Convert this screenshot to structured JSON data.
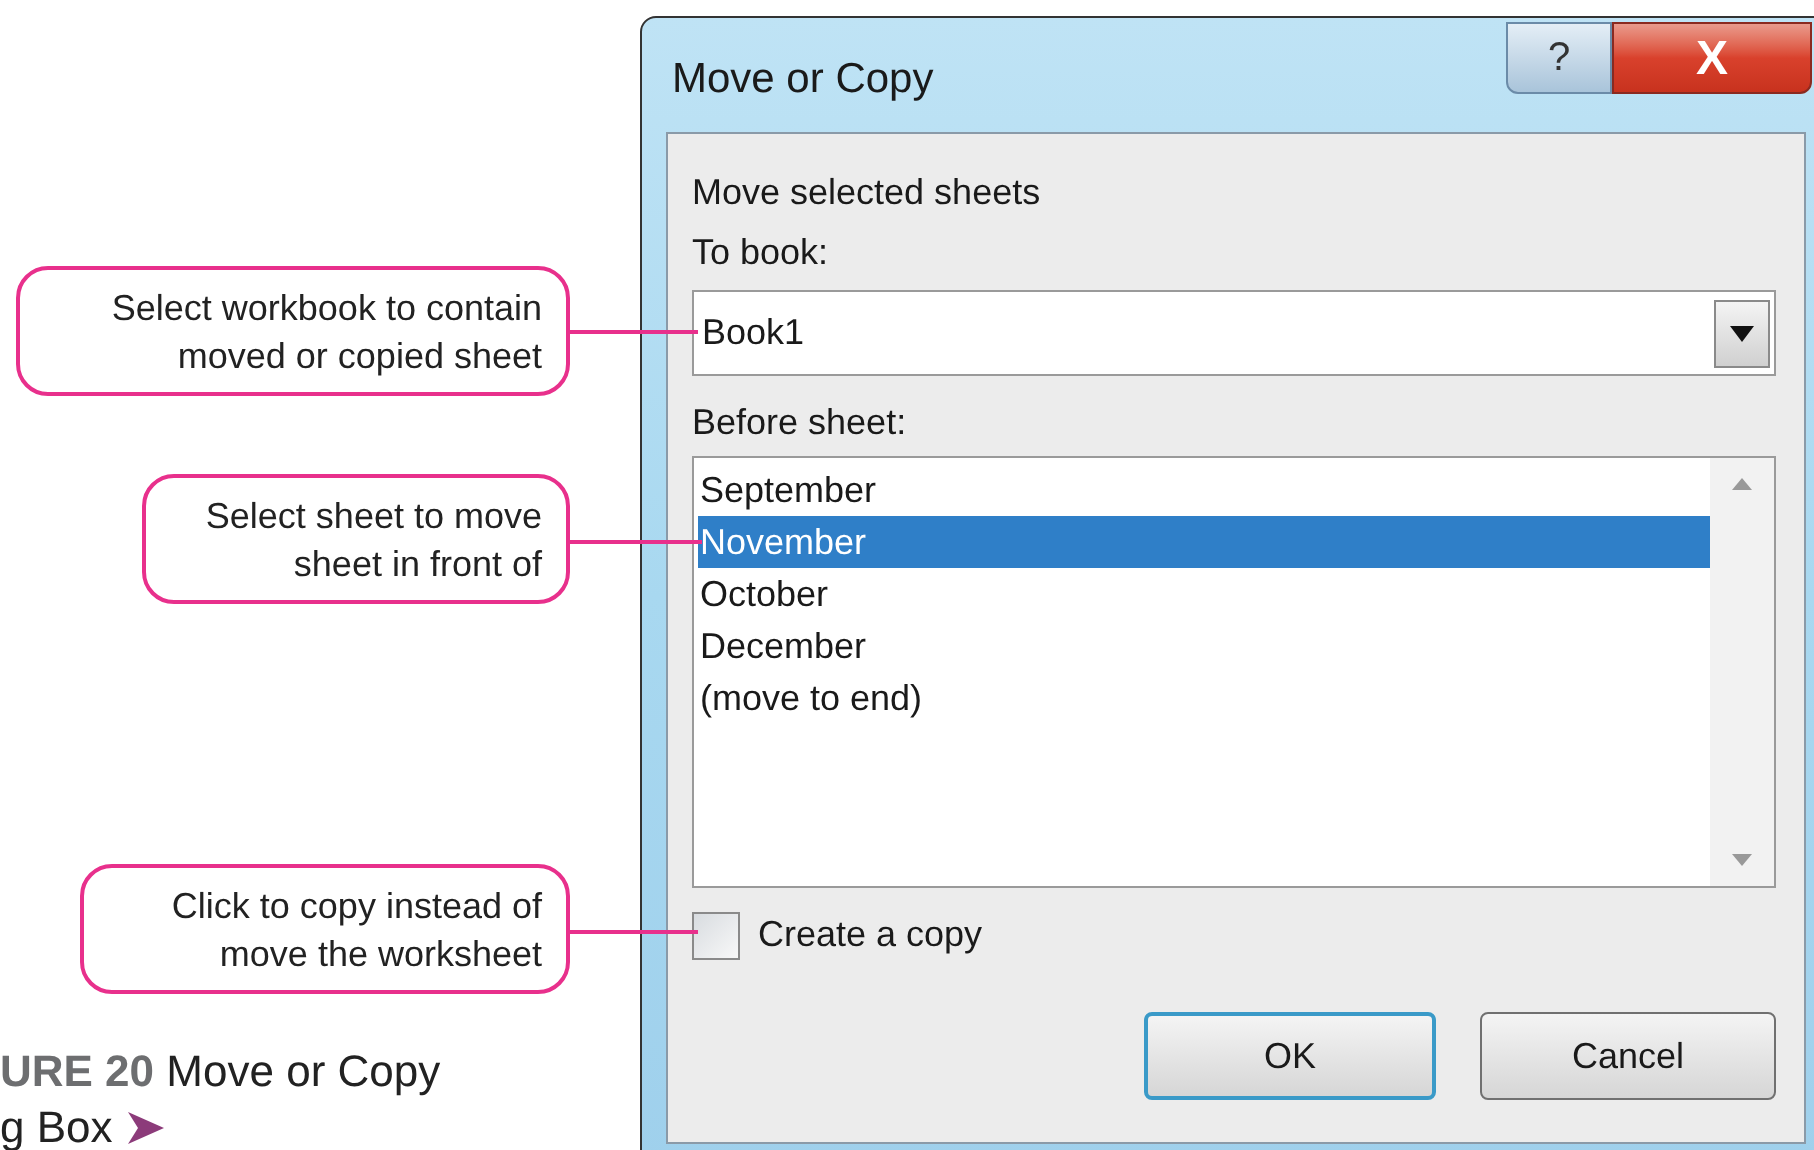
{
  "callouts": [
    {
      "text": "Select workbook to contain moved or copied sheet"
    },
    {
      "text": "Select sheet to move sheet in front of"
    },
    {
      "text": "Click to copy instead of move the worksheet"
    }
  ],
  "caption": {
    "label": "URE 20",
    "title": "Move or Copy",
    "line_2": "g Box"
  },
  "window": {
    "title": "Move or Copy",
    "help_button": "?",
    "close_button": "X"
  },
  "heading": "Move selected sheets",
  "to_book": {
    "label": "To book:",
    "value": "Book1"
  },
  "before_sheet": {
    "label": "Before sheet:",
    "items": [
      {
        "text": "September",
        "selected": false
      },
      {
        "text": "November",
        "selected": true
      },
      {
        "text": "October",
        "selected": false
      },
      {
        "text": "December",
        "selected": false
      },
      {
        "text": "(move to end)",
        "selected": false
      }
    ]
  },
  "create_copy": {
    "label": "Create a copy",
    "checked": false
  },
  "buttons": [
    {
      "label": "OK",
      "default": true
    },
    {
      "label": "Cancel",
      "default": false
    }
  ]
}
